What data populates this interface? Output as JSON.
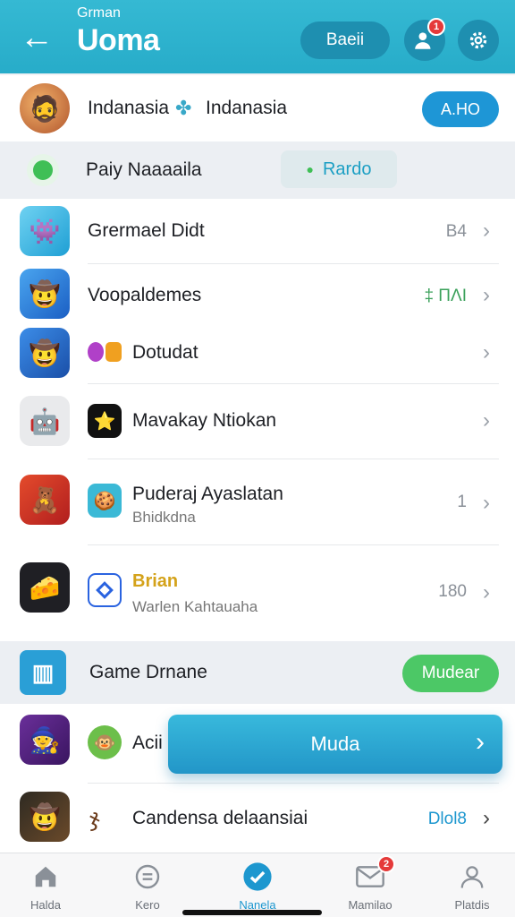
{
  "header": {
    "suptitle": "Grman",
    "title": "Uoma",
    "pill_label": "Baeii",
    "notification_count": "1",
    "back_icon": "arrow-left-icon",
    "user_icon": "user-plus-icon",
    "settings_icon": "gear-icon"
  },
  "top_item": {
    "name": "Indanasia",
    "name2": "Indanasia",
    "button": "A.HO"
  },
  "section1": {
    "label": "Paiy  Naaaaila",
    "chip": "Rardo"
  },
  "list1": [
    {
      "title": "Grermael Didt",
      "meta": "B4"
    },
    {
      "title": "Voopaldemes",
      "meta": "‡ ΠΛΙ"
    },
    {
      "title": "Dotudat",
      "meta": ""
    },
    {
      "title": "Mavakay Ntiokan",
      "meta": ""
    },
    {
      "title": "Puderaj Ayaslatan",
      "sub": "Bhidkdna",
      "meta": "1"
    },
    {
      "title": "Brian",
      "sub": "Warlen Kahtauaha",
      "meta": "180"
    }
  ],
  "section2": {
    "label": "Game  Drnane",
    "button": "Mudear"
  },
  "list2": [
    {
      "title": "Acii"
    },
    {
      "title": "Candensa delaansiai",
      "meta": "Dlol8"
    }
  ],
  "popup": {
    "label": "Muda"
  },
  "nav": [
    {
      "label": "Halda",
      "icon": "home-icon"
    },
    {
      "label": "Kero",
      "icon": "chat-icon"
    },
    {
      "label": "Nanela",
      "icon": "check-circle-icon"
    },
    {
      "label": "Mamilao",
      "icon": "mail-icon",
      "badge": "2"
    },
    {
      "label": "Platdis",
      "icon": "profile-icon"
    }
  ],
  "colors": {
    "accent": "#2aaecb",
    "active": "#1d97cf",
    "green": "#4cc866"
  }
}
